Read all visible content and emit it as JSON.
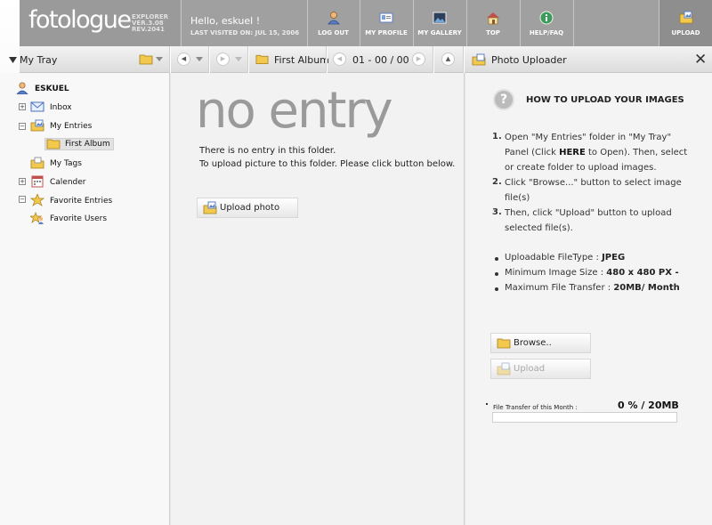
{
  "app": {
    "logo_word": "fotologue",
    "logo_version_lines": [
      "EXPLORER",
      "VER.3.08",
      "REV.2041"
    ],
    "greeting": "Hello, eskuel !",
    "last_visited": "LAST VISITED ON: JUL 15, 2006"
  },
  "nav": [
    {
      "label": "LOG OUT",
      "icon": "user-icon"
    },
    {
      "label": "MY PROFILE",
      "icon": "profile-card-icon"
    },
    {
      "label": "MY GALLERY",
      "icon": "gallery-icon"
    },
    {
      "label": "TOP",
      "icon": "home-icon"
    },
    {
      "label": "HELP/FAQ",
      "icon": "info-icon"
    },
    {
      "label": "UPLOAD",
      "icon": "upload-icon"
    }
  ],
  "toolbar": {
    "tray_title": "My Tray",
    "album_title": "First Album",
    "page_counter": "01 - 00 / 00",
    "uploader_title": "Photo Uploader"
  },
  "tray": {
    "user": "ESKUEL",
    "items": [
      {
        "label": "Inbox",
        "icon": "envelope-icon"
      },
      {
        "label": "My Entries",
        "icon": "entries-icon"
      },
      {
        "label": "First Album",
        "icon": "folder-icon"
      },
      {
        "label": "My Tags",
        "icon": "tag-folder-icon"
      },
      {
        "label": "Calender",
        "icon": "calendar-icon"
      },
      {
        "label": "Favorite Entries",
        "icon": "star-icon"
      },
      {
        "label": "Favorite Users",
        "icon": "star-user-icon"
      }
    ]
  },
  "center": {
    "heading": "no entry",
    "line1": "There is no entry in this folder.",
    "line2": "To upload picture to this folder. Please click button below.",
    "upload_button": "Upload photo"
  },
  "uploader": {
    "howto_title": "HOW TO UPLOAD YOUR IMAGES",
    "steps": [
      {
        "num": "1.",
        "lines": [
          "Open \"My Entries\" folder in \"My Tray\"",
          "Panel (Click ",
          "HERE",
          " to Open). Then, select",
          "or create folder to upload images."
        ]
      },
      {
        "num": "2.",
        "lines": [
          "Click \"Browse...\" button to select image",
          "file(s)"
        ]
      },
      {
        "num": "3.",
        "lines": [
          "Then, click \"Upload\" button to upload",
          "selected file(s)."
        ]
      }
    ],
    "filetype_label": "Uploadable FileType : ",
    "filetype_value": "JPEG",
    "minsize_label": "Minimum Image Size : ",
    "minsize_value": "480 x 480 PX -",
    "maxtransfer_label": "Maximum File Transfer : ",
    "maxtransfer_value": "20MB/ Month",
    "browse_button": "Browse..",
    "upload_button": "Upload",
    "transfer_label": "File Transfer of this Month :",
    "transfer_value": "0 % / 20MB",
    "transfer_fraction": 0.0
  }
}
